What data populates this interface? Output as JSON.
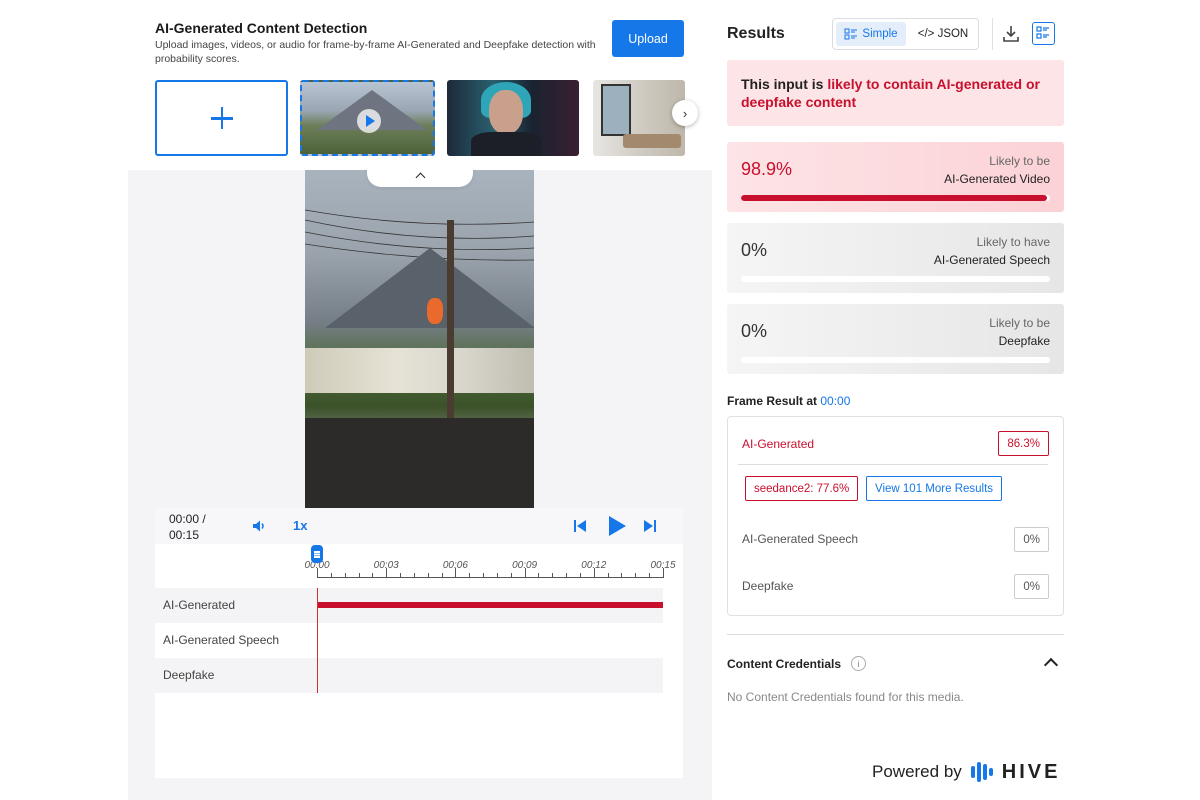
{
  "app": {
    "title": "AI-Generated Content Detection",
    "subtitle": "Upload images, videos, or audio for frame-by-frame AI-Generated and Deepfake detection with probability scores.",
    "upload_label": "Upload"
  },
  "player": {
    "time": "00:00 / 00:15",
    "speed": "1x",
    "ticks": [
      "00:00",
      "00:03",
      "00:06",
      "00:09",
      "00:12",
      "00:15"
    ],
    "tracks": [
      "AI-Generated",
      "AI-Generated Speech",
      "Deepfake"
    ],
    "position_fraction": 0
  },
  "results": {
    "title": "Results",
    "view_simple": "Simple",
    "view_json": "</> JSON",
    "verdict_prefix": "This input is ",
    "verdict_highlight": "likely to contain AI-generated or deepfake content",
    "cards": [
      {
        "pct": "98.9%",
        "line1": "Likely to be",
        "line2": "AI-Generated Video",
        "fraction": 0.989
      },
      {
        "pct": "0%",
        "line1": "Likely to have",
        "line2": "AI-Generated Speech",
        "fraction": 0
      },
      {
        "pct": "0%",
        "line1": "Likely to be",
        "line2": "Deepfake",
        "fraction": 0
      }
    ],
    "frame_prefix": "Frame Result at ",
    "frame_time": "00:00",
    "frame": {
      "ai_label": "AI-Generated",
      "ai_value": "86.3%",
      "model_tag": "seedance2: 77.6%",
      "more_label": "View 101 More Results",
      "speech_label": "AI-Generated Speech",
      "speech_value": "0%",
      "deepfake_label": "Deepfake",
      "deepfake_value": "0%"
    },
    "credentials_title": "Content Credentials",
    "credentials_body": "No Content Credentials found for this media."
  },
  "footer": {
    "powered_by": "Powered by",
    "brand": "HIVE"
  },
  "colors": {
    "accent": "#1677e8",
    "alert": "#c8102e"
  }
}
